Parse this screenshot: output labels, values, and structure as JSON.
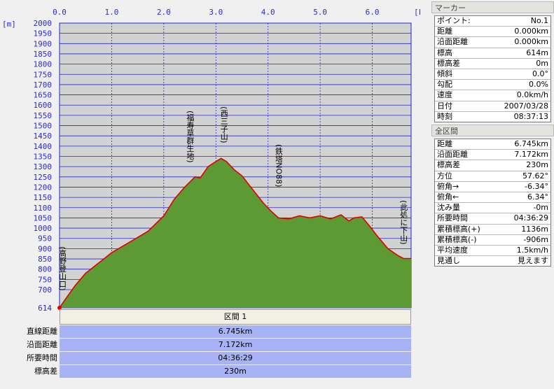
{
  "chart_data": {
    "type": "area",
    "x_unit": "[km]",
    "y_unit": "[m]",
    "xlim": [
      0,
      6.745
    ],
    "ylim": [
      614,
      2000
    ],
    "x_ticks": [
      "0.0",
      "1.0",
      "2.0",
      "3.0",
      "4.0",
      "5.0",
      "6.0"
    ],
    "y_ticks": [
      "2000",
      "1950",
      "1900",
      "1850",
      "1800",
      "1750",
      "1700",
      "1650",
      "1600",
      "1550",
      "1500",
      "1450",
      "1400",
      "1350",
      "1300",
      "1250",
      "1200",
      "1150",
      "1100",
      "1050",
      "1000",
      "950",
      "900",
      "850",
      "800",
      "750",
      "700",
      "614"
    ],
    "grid": true,
    "x": [
      0.0,
      0.1,
      0.3,
      0.5,
      0.8,
      1.0,
      1.3,
      1.7,
      2.0,
      2.2,
      2.4,
      2.6,
      2.7,
      2.85,
      3.0,
      3.1,
      3.2,
      3.35,
      3.5,
      3.7,
      3.9,
      4.05,
      4.2,
      4.4,
      4.6,
      4.8,
      5.0,
      5.2,
      5.4,
      5.55,
      5.65,
      5.8,
      5.95,
      6.1,
      6.3,
      6.5,
      6.6,
      6.745
    ],
    "y": [
      614,
      650,
      720,
      780,
      840,
      880,
      925,
      985,
      1060,
      1140,
      1200,
      1250,
      1245,
      1300,
      1325,
      1340,
      1325,
      1285,
      1255,
      1190,
      1125,
      1085,
      1050,
      1045,
      1060,
      1050,
      1060,
      1045,
      1065,
      1035,
      1050,
      1055,
      1010,
      960,
      900,
      865,
      852,
      852
    ],
    "annotations": [
      {
        "x": 0.0,
        "text": "(高野登山口)"
      },
      {
        "x": 2.45,
        "text": "(福寿草群生地)"
      },
      {
        "x": 3.1,
        "text": "(西三子山)"
      },
      {
        "x": 4.15,
        "text": "(鉄塔NO88)"
      },
      {
        "x": 6.6,
        "text": "(此処に下山)"
      }
    ]
  },
  "section": {
    "title": "区間 1",
    "rows": [
      {
        "label": "直線距離",
        "value": "6.745km"
      },
      {
        "label": "沿面距離",
        "value": "7.172km"
      },
      {
        "label": "所要時間",
        "value": "04:36:29"
      },
      {
        "label": "標高差",
        "value": "230m"
      }
    ]
  },
  "marker": {
    "title": "マーカー",
    "rows": [
      {
        "k": "ポイント:",
        "v": "No.1"
      },
      {
        "k": "距離",
        "v": "0.000km"
      },
      {
        "k": "沿面距離",
        "v": "0.000km"
      },
      {
        "k": "標高",
        "v": "614m"
      },
      {
        "k": "標高差",
        "v": "0m"
      },
      {
        "k": "傾斜",
        "v": "0.0°"
      },
      {
        "k": "勾配",
        "v": "0.0%"
      },
      {
        "k": "速度",
        "v": "0.0km/h"
      },
      {
        "k": "日付",
        "v": "2007/03/28"
      },
      {
        "k": "時刻",
        "v": "08:37:13"
      }
    ]
  },
  "all_section": {
    "title": "全区間",
    "rows": [
      {
        "k": "距離",
        "v": "6.745km"
      },
      {
        "k": "沿面距離",
        "v": "7.172km"
      },
      {
        "k": "標高差",
        "v": "230m"
      },
      {
        "k": "方位",
        "v": "57.62°"
      },
      {
        "k": "俯角→",
        "v": "-6.34°"
      },
      {
        "k": "俯角←",
        "v": "6.34°"
      },
      {
        "k": "沈み量",
        "v": "-0m"
      },
      {
        "k": "所要時間",
        "v": "04:36:29"
      },
      {
        "k": "累積標高(+)",
        "v": "1136m"
      },
      {
        "k": "累積標高(-)",
        "v": "-906m"
      },
      {
        "k": "平均速度",
        "v": "1.5km/h"
      },
      {
        "k": "見通し",
        "v": "見えます"
      }
    ]
  },
  "colors": {
    "plot_bg": "#d2d2d2",
    "fill": "#5e9a34",
    "line": "#e00000",
    "grid": "#2828c8",
    "summary_bg": "#a7b3f4"
  }
}
